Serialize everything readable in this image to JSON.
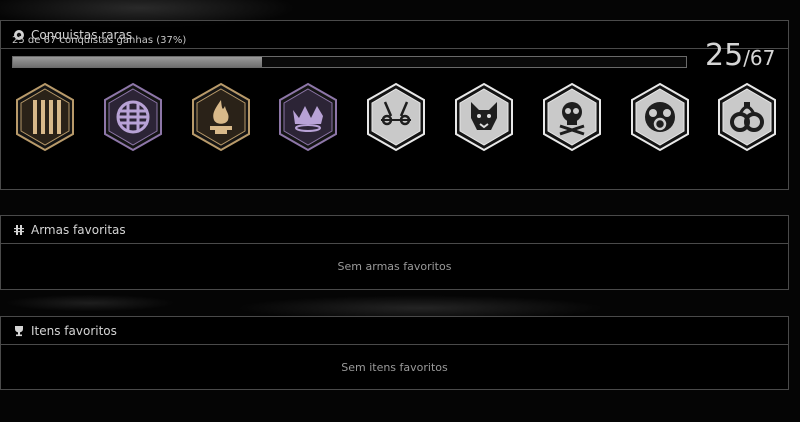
{
  "rare_achievements": {
    "title": "Conquistas raras",
    "header_icon": "gear-circle-icon",
    "progress_text": "25 de 67 conquistas ganhas (37%)",
    "progress_fraction": 0.37,
    "earned": "25",
    "total_text": "/67",
    "badges": [
      {
        "icon": "prison-bars-icon",
        "tier": "gold"
      },
      {
        "icon": "globe-grid-icon",
        "tier": "purple"
      },
      {
        "icon": "flame-icon",
        "tier": "gold"
      },
      {
        "icon": "crown-icon",
        "tier": "purple"
      },
      {
        "icon": "tripwire-icon",
        "tier": "silver"
      },
      {
        "icon": "wolf-head-icon",
        "tier": "silver"
      },
      {
        "icon": "skull-crossbones-icon",
        "tier": "silver"
      },
      {
        "icon": "gas-mask-icon",
        "tier": "silver"
      },
      {
        "icon": "handcuffs-icon",
        "tier": "silver"
      }
    ],
    "tier_colors": {
      "gold": {
        "fill": "#2a2218",
        "stroke": "#b89a6a",
        "glyph": "#d8b98a"
      },
      "purple": {
        "fill": "#2c2436",
        "stroke": "#8d76a8",
        "glyph": "#b8a2d6"
      },
      "silver": {
        "fill": "#c9c9c9",
        "stroke": "#e8e8e8",
        "glyph": "#1e1e1e"
      }
    }
  },
  "favorite_weapons": {
    "title": "Armas favoritas",
    "header_icon": "bullets-icon",
    "empty_text": "Sem armas favoritos"
  },
  "favorite_items": {
    "title": "Itens favoritos",
    "header_icon": "trophy-icon",
    "empty_text": "Sem itens favoritos"
  }
}
